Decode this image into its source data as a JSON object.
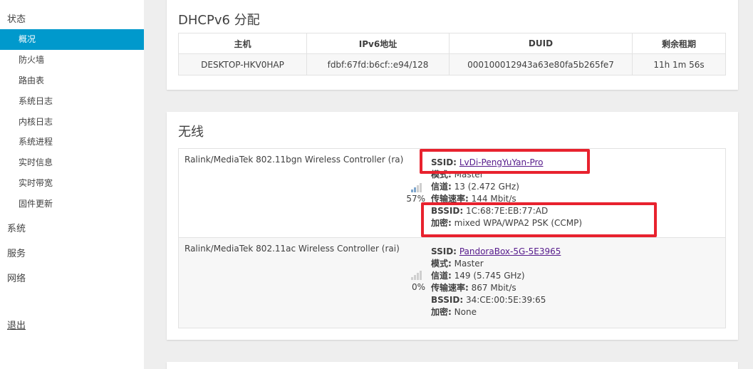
{
  "sidebar": {
    "status": "状态",
    "sub_items": [
      "概况",
      "防火墙",
      "路由表",
      "系统日志",
      "内核日志",
      "系统进程",
      "实时信息",
      "实时带宽",
      "固件更新"
    ],
    "system": "系统",
    "services": "服务",
    "network": "网络",
    "logout": "退出"
  },
  "dhcpv6": {
    "title": "DHCPv6 分配",
    "columns": [
      "主机",
      "IPv6地址",
      "DUID",
      "剩余租期"
    ],
    "row": [
      "DESKTOP-HKV0HAP",
      "fdbf:67fd:b6cf::e94/128",
      "000100012943a63e80fa5b265fe7",
      "11h 1m 56s"
    ]
  },
  "wireless": {
    "title": "无线",
    "labels": {
      "ssid": "SSID:",
      "mode": "模式:",
      "channel": "信道:",
      "rate": "传输速率:",
      "bssid": "BSSID:",
      "encryption": "加密:"
    },
    "devices": [
      {
        "name": "Ralink/MediaTek 802.11bgn Wireless Controller (ra)",
        "signal": "57%",
        "signal_level": 0.57,
        "ssid": "LvDi-PengYuYan-Pro",
        "mode": "Master",
        "channel": "13 (2.472 GHz)",
        "rate": "144 Mbit/s",
        "bssid": "1C:68:7E:EB:77:AD",
        "encryption": "mixed WPA/WPA2 PSK (CCMP)"
      },
      {
        "name": "Ralink/MediaTek 802.11ac Wireless Controller (rai)",
        "signal": "0%",
        "signal_level": 0,
        "ssid": "PandoraBox-5G-5E3965",
        "mode": "Master",
        "channel": "149 (5.745 GHz)",
        "rate": "867 Mbit/s",
        "bssid": "34:CE:00:5E:39:65",
        "encryption": "None"
      }
    ]
  },
  "colors": {
    "accent": "#0099cc",
    "highlight": "#e8222e",
    "signal_on": "#7fa6cc",
    "signal_off": "#cfcfcf"
  }
}
